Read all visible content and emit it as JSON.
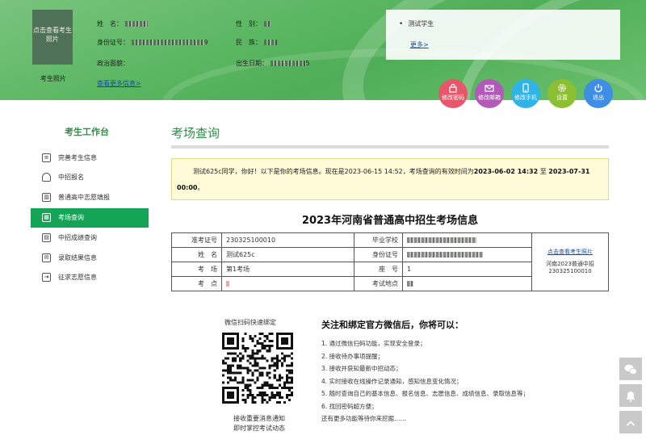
{
  "header": {
    "photo_hint": "点击查看考生照片",
    "photo_label": "考生照片",
    "labels": {
      "name": "姓　名：",
      "id_no": "身份证号：",
      "political": "政治面貌：",
      "gender": "性　别：",
      "ethnicity": "民　族：",
      "birth": "出生日期："
    },
    "id_no_suffix": "9",
    "birth_suffix": "5",
    "view_more": "查看更多信息>",
    "notice": "测试学生",
    "notice_more": "更多>"
  },
  "toolbar": [
    {
      "label": "修改密码",
      "icon": "lock-icon",
      "color": "#e8566a"
    },
    {
      "label": "修改邮箱",
      "icon": "mail-icon",
      "color": "#b35ab8"
    },
    {
      "label": "修改手机",
      "icon": "phone-icon",
      "color": "#2fb3e8"
    },
    {
      "label": "设置",
      "icon": "gear-icon",
      "color": "#8cbf32"
    },
    {
      "label": "退出",
      "icon": "power-icon",
      "color": "#3f8ee6"
    }
  ],
  "nav": {
    "title": "考生工作台",
    "items": [
      {
        "label": "完善考生信息",
        "icon": "id-card-icon"
      },
      {
        "label": "中招报名",
        "icon": "bell-icon"
      },
      {
        "label": "普通高中志愿填报",
        "icon": "building-icon"
      },
      {
        "label": "考场查询",
        "icon": "grid-icon"
      },
      {
        "label": "中招成绩查询",
        "icon": "score-icon"
      },
      {
        "label": "录取结果信息",
        "icon": "envelope-icon"
      },
      {
        "label": "征求志愿信息",
        "icon": "export-icon"
      }
    ],
    "active_index": 3
  },
  "main": {
    "title": "考场查询",
    "alert_pre": "测试625c同学，你好！以下是你的考场信息。现在是2023-06-15 14:52，考场查询的有效时间为",
    "alert_from": "2023-06-02 14:32",
    "alert_mid": " 至 ",
    "alert_to": "2023-07-31 00:00",
    "alert_end": "。",
    "exam_title": "2023年河南省普通高中招生考场信息",
    "table": {
      "ticket_label": "准考证号",
      "ticket_value": "230325100010",
      "school_label": "毕业学校",
      "name_label": "姓　名",
      "name_value": "测试625c",
      "idno_label": "身份证号",
      "room_label": "考　场",
      "room_value": "第1考场",
      "seat_label": "座　号",
      "seat_value": "1",
      "site_label": "考　点",
      "addr_label": "考试地点",
      "side_link": "点击查看考生照片",
      "side_text": "河南2023普通中招230325100010"
    },
    "qr_top": "微信扫码快速绑定",
    "qr_bottom_1": "接收重要消息通知",
    "qr_bottom_2": "即时掌控考试动态",
    "follow_title": "关注和绑定官方微信后，你将可以：",
    "follow_items": [
      "1. 通过微信扫码功能，实现安全登录；",
      "2. 接收待办事项提醒；",
      "3. 接收并获知最新中招动态；",
      "4. 实时接收在线操作记录通知，感知信息变化情况；",
      "5. 随时查询自己的基本信息、报名信息、志愿信息、成绩信息、录取信息等；",
      "6. 找回密码超方便；",
      "还有更多功能等待你来挖掘……"
    ]
  },
  "float_buttons": [
    "wechat-icon",
    "bell-icon",
    "back-to-top-icon"
  ]
}
